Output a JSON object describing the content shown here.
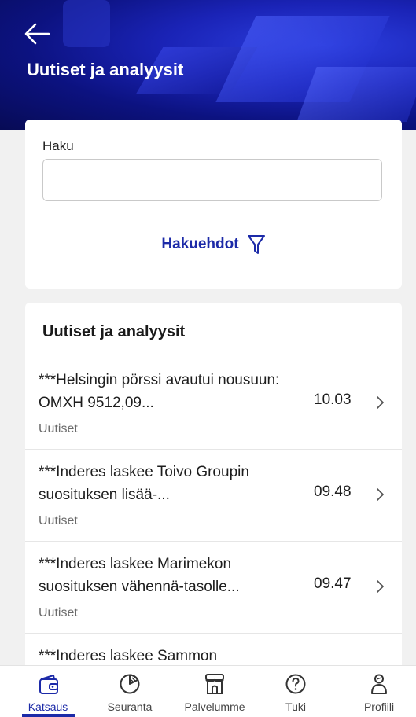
{
  "header": {
    "title": "Uutiset ja analyysit",
    "back_icon": "arrow-left-icon"
  },
  "search": {
    "label": "Haku",
    "value": "",
    "placeholder": "",
    "filter_label": "Hakuehdot",
    "filter_icon": "funnel-icon"
  },
  "news": {
    "heading": "Uutiset ja analyysit",
    "items": [
      {
        "title": "***Helsingin pörssi avautui nousuun: OMXH 9512,09...",
        "category": "Uutiset",
        "time": "10.03"
      },
      {
        "title": "***Inderes laskee Toivo Groupin suosituksen lisää-...",
        "category": "Uutiset",
        "time": "09.48"
      },
      {
        "title": "***Inderes laskee Marimekon suosituksen vähennä-tasolle...",
        "category": "Uutiset",
        "time": "09.47"
      },
      {
        "title": "***Inderes laskee Sammon",
        "category": "",
        "time": ""
      }
    ]
  },
  "nav": {
    "items": [
      {
        "label": "Katsaus",
        "icon": "wallet-icon",
        "active": true
      },
      {
        "label": "Seuranta",
        "icon": "pie-chart-icon",
        "active": false
      },
      {
        "label": "Palvelumme",
        "icon": "store-icon",
        "active": false
      },
      {
        "label": "Tuki",
        "icon": "question-icon",
        "active": false
      },
      {
        "label": "Profiili",
        "icon": "person-icon",
        "active": false
      }
    ]
  },
  "colors": {
    "accent": "#1c2aa8",
    "header_bg": "#0c1280",
    "page_bg": "#f1f1f1"
  }
}
